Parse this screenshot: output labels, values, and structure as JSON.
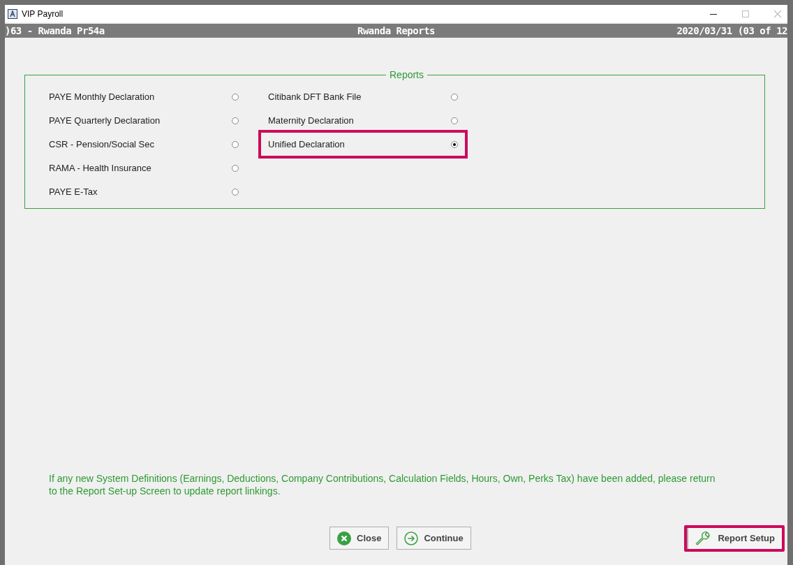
{
  "window": {
    "title": "VIP Payroll"
  },
  "header": {
    "left": ")63 - Rwanda Pr54a",
    "center": "Rwanda Reports",
    "right": "2020/03/31 (03 of 12"
  },
  "group": {
    "title": "Reports",
    "columns": [
      [
        {
          "label": "PAYE Monthly Declaration",
          "selected": false,
          "highlighted": false
        },
        {
          "label": "PAYE Quarterly Declaration",
          "selected": false,
          "highlighted": false
        },
        {
          "label": "CSR - Pension/Social Sec",
          "selected": false,
          "highlighted": false
        },
        {
          "label": "RAMA - Health Insurance",
          "selected": false,
          "highlighted": false
        },
        {
          "label": "PAYE E-Tax",
          "selected": false,
          "highlighted": false
        }
      ],
      [
        {
          "label": "Citibank DFT Bank File",
          "selected": false,
          "highlighted": false
        },
        {
          "label": "Maternity Declaration",
          "selected": false,
          "highlighted": false
        },
        {
          "label": "Unified Declaration",
          "selected": true,
          "highlighted": true
        }
      ]
    ]
  },
  "note": "If any new System Definitions (Earnings, Deductions, Company Contributions, Calculation Fields, Hours, Own, Perks Tax) have been added, please return to the Report Set-up Screen to update report linkings.",
  "buttons": [
    {
      "kind": "close",
      "label": "Close",
      "highlighted": false
    },
    {
      "kind": "continue",
      "label": "Continue",
      "highlighted": false
    },
    {
      "kind": "setup",
      "label": "Report Setup",
      "highlighted": true
    }
  ]
}
